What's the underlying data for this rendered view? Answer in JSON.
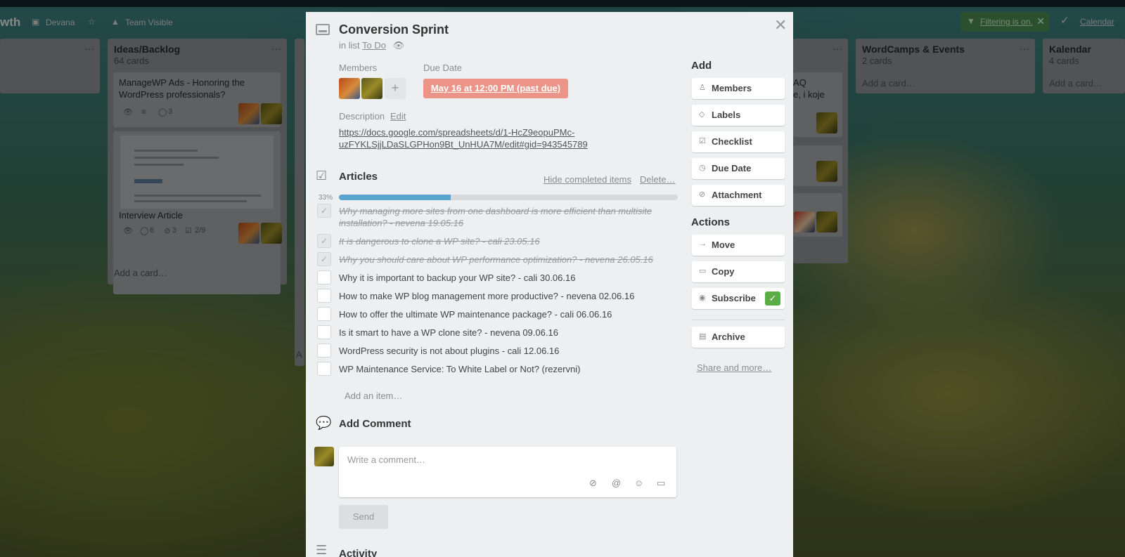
{
  "board": {
    "title_fragment": "wth",
    "members_label": "Devana",
    "team_label": "Team Visible",
    "filter_label": "Filtering is on.",
    "calendar_label": "Calendar"
  },
  "lists": [
    {
      "name": "Ideas/Backlog",
      "count": "64 cards",
      "cards": [
        {
          "title": "ManageWP Ads - Honoring the WordPress professionals?",
          "comments": "3"
        },
        {
          "title": "Interview Article",
          "comments": "6",
          "attachments": "3",
          "checklist": "2/9"
        }
      ],
      "add_card": "Add a card…"
    },
    {
      "name": "WordCamps & Events",
      "count": "2 cards",
      "add_card": "Add a card…"
    },
    {
      "name": "Kalendar",
      "count": "4 cards",
      "add_card": "Add a card…"
    }
  ],
  "partial_text": {
    "faq": "AQ",
    "koje": "e, i koje",
    "left_edge": "A"
  },
  "card": {
    "title": "Conversion Sprint",
    "in_list_prefix": "in list",
    "list_name": "To Do",
    "members_label": "Members",
    "due_label": "Due Date",
    "due_value": "May 16 at 12:00 PM (past due)",
    "description_label": "Description",
    "description_edit": "Edit",
    "description_link_line1": "https://docs.google.com/spreadsheets/d/1-HcZ9eopuPMc-",
    "description_link_line2": "uzFYKLSjjLDaSLGPHon9Bt_UnHUA7M/edit#gid=943545789",
    "checklist": {
      "title": "Articles",
      "hide_completed": "Hide completed items",
      "delete": "Delete…",
      "percent_label": "33%",
      "progress": 0.33,
      "items": [
        {
          "text": "Why managing more sites from one dashboard is more efficient than multisite installation? - nevena 19.05.16",
          "done": true
        },
        {
          "text": "It is dangerous to clone a WP site? - cali 23.05.16",
          "done": true
        },
        {
          "text": "Why you should care about WP performance optimization? - nevena 26.05.16",
          "done": true
        },
        {
          "text": "Why it is important to backup your WP site? - cali 30.06.16",
          "done": false
        },
        {
          "text": "How to make WP blog management more productive? - nevena 02.06.16",
          "done": false
        },
        {
          "text": "How to offer the ultimate WP maintenance package? - cali 06.06.16",
          "done": false
        },
        {
          "text": "Is it smart to have a WP clone site? - nevena 09.06.16",
          "done": false
        },
        {
          "text": "WordPress security is not about plugins - cali 12.06.16",
          "done": false
        },
        {
          "text": "WP Maintenance Service: To White Label or Not? (rezervni)",
          "done": false
        }
      ],
      "add_item": "Add an item…"
    },
    "comment": {
      "title": "Add Comment",
      "placeholder": "Write a comment…",
      "send": "Send"
    },
    "activity_title": "Activity"
  },
  "sidebar": {
    "add_title": "Add",
    "add_buttons": [
      "Members",
      "Labels",
      "Checklist",
      "Due Date",
      "Attachment"
    ],
    "actions_title": "Actions",
    "action_buttons": [
      "Move",
      "Copy",
      "Subscribe",
      "Archive"
    ],
    "share": "Share and more…"
  },
  "colors": {
    "due_badge": "#ec9488",
    "progress": "#5ba4cf",
    "subscribed": "#5aac44",
    "filter": "#4a8a4f"
  }
}
